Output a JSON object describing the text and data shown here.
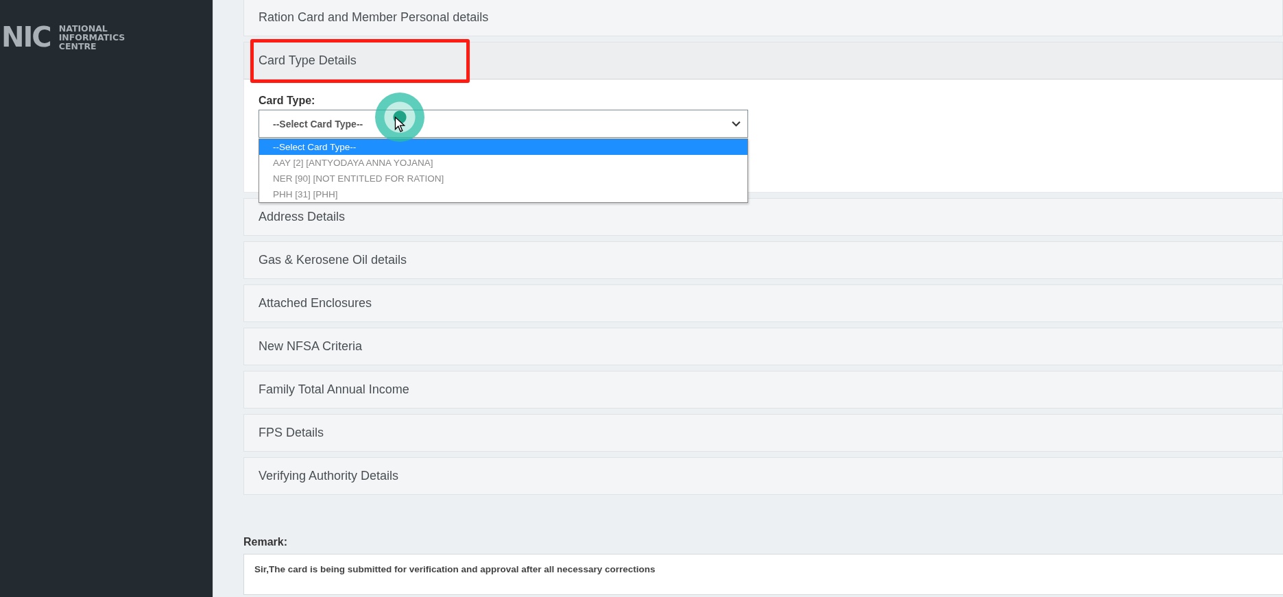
{
  "sidebar": {
    "logo": {
      "mark": "NIC",
      "lines": [
        "NATIONAL",
        "INFORMATICS",
        "CENTRE"
      ]
    }
  },
  "sections": [
    {
      "title": "Ration Card and Member Personal details",
      "expanded": false,
      "highlighted": false
    },
    {
      "title": "Card Type Details",
      "expanded": true,
      "highlighted": true,
      "field": {
        "label": "Card Type:",
        "value": "--Select Card Type--",
        "open": true,
        "options": [
          {
            "label": "--Select Card Type--",
            "selected": true
          },
          {
            "label": "AAY [2] [ANTYODAYA ANNA YOJANA]",
            "selected": false
          },
          {
            "label": "NER [90] [NOT ENTITLED FOR RATION]",
            "selected": false
          },
          {
            "label": "PHH [31] [PHH]",
            "selected": false
          }
        ]
      }
    },
    {
      "title": "Address Details",
      "expanded": false,
      "highlighted": false
    },
    {
      "title": "Gas & Kerosene Oil details",
      "expanded": false,
      "highlighted": false
    },
    {
      "title": "Attached Enclosures",
      "expanded": false,
      "highlighted": false
    },
    {
      "title": "New NFSA Criteria",
      "expanded": false,
      "highlighted": false
    },
    {
      "title": "Family Total Annual Income",
      "expanded": false,
      "highlighted": false
    },
    {
      "title": "FPS Details",
      "expanded": false,
      "highlighted": false
    },
    {
      "title": "Verifying Authority Details",
      "expanded": false,
      "highlighted": false
    }
  ],
  "remark": {
    "label": "Remark:",
    "value": "Sir,The card is being submitted for verification and approval after all necessary corrections"
  }
}
